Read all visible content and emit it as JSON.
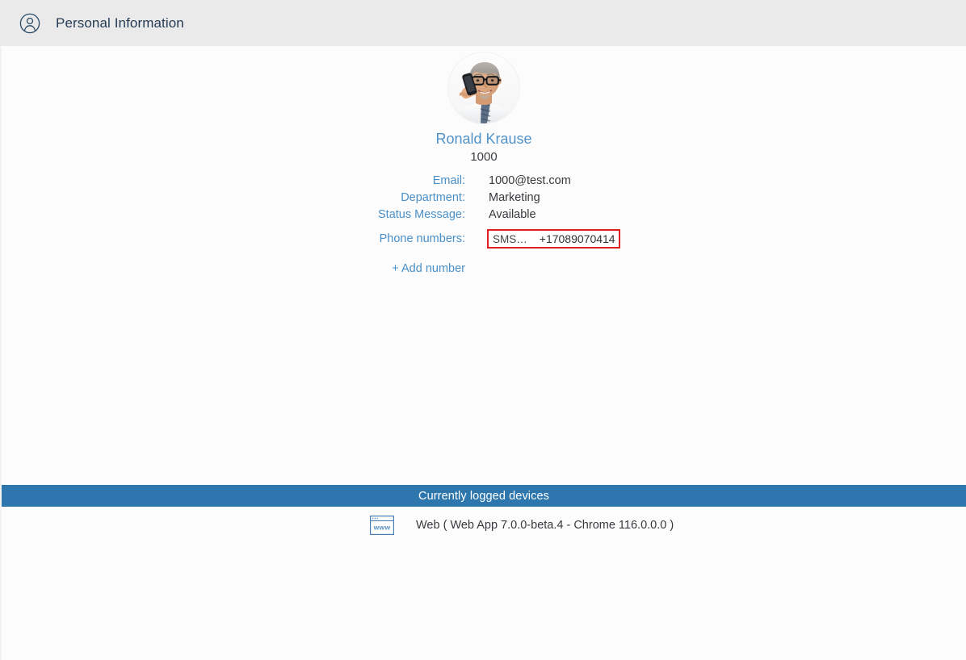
{
  "header": {
    "icon": "user-circle-icon",
    "title": "Personal Information"
  },
  "profile": {
    "avatar_alt": "user-photo",
    "name": "Ronald Krause",
    "extension": "1000",
    "fields": [
      {
        "label": "Email:",
        "value": "1000@test.com",
        "name": "email"
      },
      {
        "label": "Department:",
        "value": "Marketing",
        "name": "department"
      },
      {
        "label": "Status Message:",
        "value": "Available",
        "name": "status-message"
      }
    ],
    "phones_label": "Phone numbers:",
    "phone": {
      "type": "SMS…",
      "number": "+17089070414",
      "border_color": "#e02020"
    },
    "add_number_label": "+ Add number"
  },
  "devices": {
    "banner_title": "Currently logged devices",
    "banner_color": "#2e77ae",
    "items": [
      {
        "icon": "www-browser-icon",
        "label": "Web ( Web App 7.0.0-beta.4 - Chrome 116.0.0.0 )"
      }
    ]
  },
  "colors": {
    "header_bg": "#eaeaea",
    "page_bg": "#fcfcfd",
    "label_blue": "#4a90c8",
    "name_blue": "#5193c9",
    "accent_blue": "#2e77ae",
    "error_red": "#e02020"
  }
}
